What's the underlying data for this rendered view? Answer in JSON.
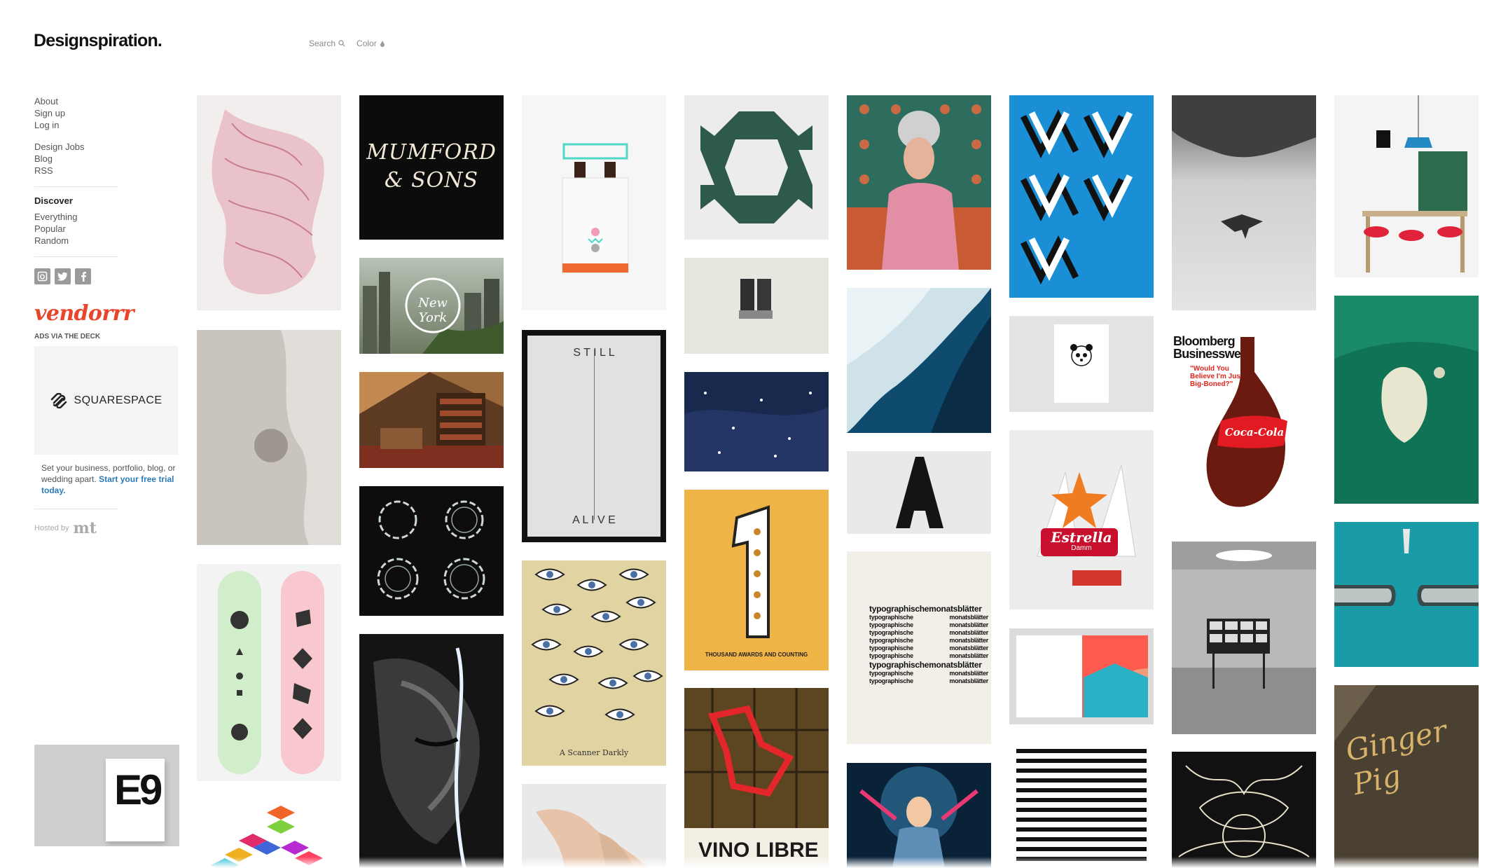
{
  "brand": {
    "name": "Designspiration",
    "dot": "."
  },
  "topnav": {
    "search": "Search",
    "color": "Color"
  },
  "sidebar": {
    "group1": [
      "About",
      "Sign up",
      "Log in"
    ],
    "group2": [
      "Design Jobs",
      "Blog",
      "RSS"
    ],
    "discover_heading": "Discover",
    "discover": [
      "Everything",
      "Popular",
      "Random"
    ],
    "social": [
      "instagram-icon",
      "twitter-icon",
      "facebook-icon"
    ]
  },
  "ad": {
    "vendor_logo": "vendorrr",
    "ads_via": "ADS VIA THE DECK",
    "sponsor": "SQUARESPACE",
    "text": "Set your business, portfolio, blog, or wedding apart.",
    "cta": "Start your free trial today.",
    "hosted_by": "Hosted by",
    "host_logo": "mt"
  },
  "grid_text": {
    "mumford_line1": "MUMFORD",
    "mumford_line2": "& SONS",
    "newyork": "New York",
    "still": "S T I L L",
    "alive": "A L I V E",
    "scanner": "A Scanner Darkly",
    "awards": "THOUSAND AWARDS AND COUNTING",
    "bloomberg1": "Bloomberg",
    "bloomberg2": "Businessweek",
    "bloomberg_quote": "\"Would You Believe I'm Just Big-Boned?\"",
    "coca": "Coca-Cola",
    "estrella": "Estrella",
    "damm": "Damm",
    "typo_big": "typographischemonatsblätter",
    "typo_a": "typographische",
    "typo_b": "monatsblätter",
    "e9": "E9",
    "ginger": "Ginger Pig",
    "vino": "VINO LIBRE"
  }
}
